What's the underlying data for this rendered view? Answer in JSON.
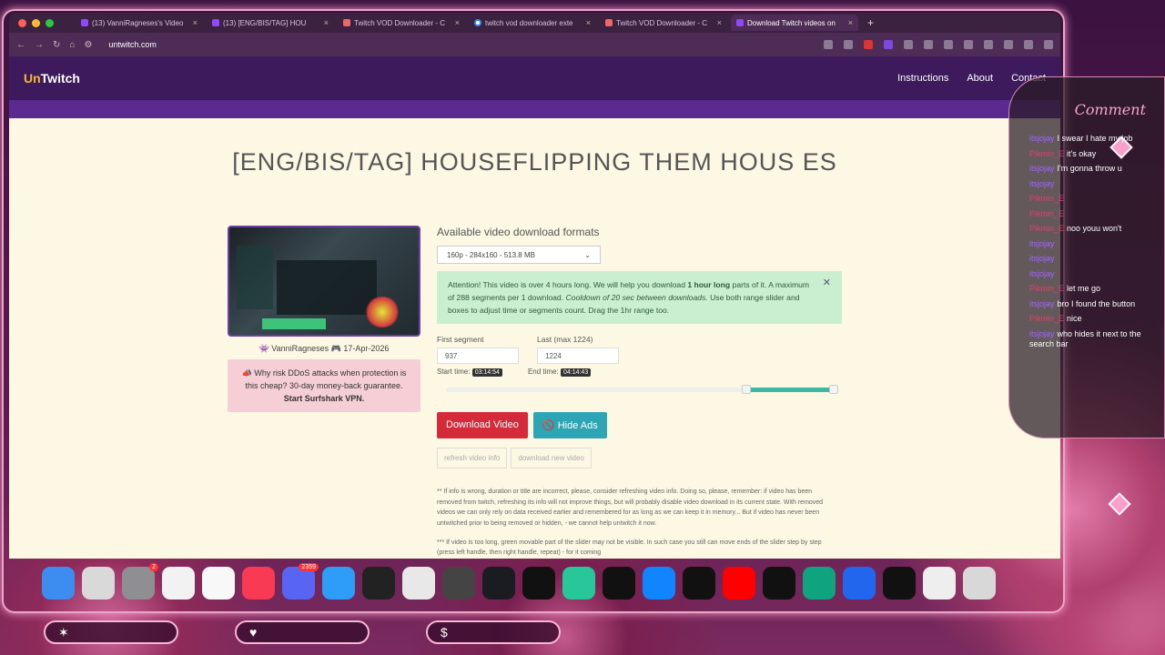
{
  "browser": {
    "tabs": [
      {
        "title": "(13) VanniRagneses's Video",
        "fav": "twitch"
      },
      {
        "title": "(13) [ENG/BIS/TAG] HOU",
        "fav": "twitch"
      },
      {
        "title": "Twitch VOD Downloader - C",
        "fav": "plugin"
      },
      {
        "title": "twitch vod downloader exte",
        "fav": "google"
      },
      {
        "title": "Twitch VOD Downloader - C",
        "fav": "plugin"
      },
      {
        "title": "Download Twitch videos on",
        "fav": "twitch"
      }
    ],
    "url": "untwitch.com"
  },
  "site": {
    "logo_a": "Un",
    "logo_b": "Twitch",
    "nav": [
      "Instructions",
      "About",
      "Contact"
    ]
  },
  "page": {
    "title": "[ENG/BIS/TAG] HOUSEFLIPPING THEM HOUS ES",
    "meta": {
      "author": "VanniRagneses",
      "date": "17-Apr-2026"
    },
    "promo_text": "Why risk DDoS attacks when protection is this cheap? 30-day money-back guarantee.",
    "promo_link": "Start Surfshark VPN.",
    "formats_heading": "Available video download formats",
    "format_selected": "160p - 284x160 - 513.8 MB",
    "alert_text_1": "Attention! This video is over 4 hours long. We will help you download ",
    "alert_bold": "1 hour long",
    "alert_text_2": " parts of it. A maximum of 288 segments per 1 download. ",
    "alert_italic": "Cooldown of 20 sec between downloads.",
    "alert_text_3": " Use both range slider and boxes to adjust time or segments count. Drag the 1hr range too.",
    "first_segment_label": "First segment",
    "first_segment_value": "937",
    "last_segment_label": "Last (max 1224)",
    "last_segment_value": "1224",
    "start_label": "Start time:",
    "start_time": "03:14:54",
    "end_label": "End time:",
    "end_time": "04:14:43",
    "slider_range": [
      0.765,
      0.985
    ],
    "download_button": "Download Video",
    "hide_ads_button": "Hide Ads",
    "refresh_button": "refresh video info",
    "new_video_button": "download new video",
    "note1": "** If info is wrong, duration or title are incorrect, please, consider refreshing video info. Doing so, please, remember: if video has been removed from twitch, refreshing its info will not improve things, but will probably disable video download in its current state. With removed videos we can only rely on data received earlier and remembered for as long as we can keep it in memory... But if video has never been untwitched prior to being removed or hidden, - we cannot help untwitch it now.",
    "note2": "*** If video is too long, green movable part of the slider may not be visible. In such case you still can move ends of the slider step by step (press left handle, then right handle, repeat) - for it coming"
  },
  "dock": {
    "icons": [
      {
        "name": "finder-icon",
        "color": "#3d8df0"
      },
      {
        "name": "launchpad-icon",
        "color": "#d9d9d9"
      },
      {
        "name": "settings-icon",
        "color": "#8e8e93",
        "badge": "2"
      },
      {
        "name": "photos-icon",
        "color": "#f2f2f2"
      },
      {
        "name": "notes-icon",
        "color": "#f8f8f8"
      },
      {
        "name": "music-icon",
        "color": "#fa3a55"
      },
      {
        "name": "discord-icon",
        "color": "#5865f2",
        "badge": "2359"
      },
      {
        "name": "safari-icon",
        "color": "#2e9df7"
      },
      {
        "name": "wave-app-icon",
        "color": "#222"
      },
      {
        "name": "chrome-icon",
        "color": "#e8e8e8"
      },
      {
        "name": "discord-alt-icon",
        "color": "#444"
      },
      {
        "name": "obs-icon",
        "color": "#1b1b22"
      },
      {
        "name": "tiktok-icon",
        "color": "#111"
      },
      {
        "name": "teams-icon",
        "color": "#28c79a"
      },
      {
        "name": "x-icon",
        "color": "#111"
      },
      {
        "name": "bluesky-icon",
        "color": "#1185fe"
      },
      {
        "name": "cursor-icon",
        "color": "#111"
      },
      {
        "name": "youtube-icon",
        "color": "#ff0000"
      },
      {
        "name": "streamlabs-icon",
        "color": "#111"
      },
      {
        "name": "chatgpt-icon",
        "color": "#10a37f"
      },
      {
        "name": "plus-app-icon",
        "color": "#2266ee"
      },
      {
        "name": "capcut-icon",
        "color": "#111"
      },
      {
        "name": "vc-icon",
        "color": "#eeeeee"
      },
      {
        "name": "trash-icon",
        "color": "#d8d8d8"
      }
    ]
  },
  "chat": {
    "title": "Comment",
    "messages": [
      {
        "user": "itsjojay",
        "color": "p",
        "text": "I swear I hate my job"
      },
      {
        "user": "Pikmin_E",
        "color": "r",
        "text": "it's okay"
      },
      {
        "user": "itsjojay",
        "color": "p",
        "text": "I'm gonna throw u"
      },
      {
        "user": "itsjojay",
        "color": "p",
        "text": ""
      },
      {
        "user": "Pikmin_E",
        "color": "r",
        "text": ""
      },
      {
        "user": "Pikmin_E",
        "color": "r",
        "text": ""
      },
      {
        "user": "Pikmin_E",
        "color": "r",
        "text": "noo youu won't"
      },
      {
        "user": "itsjojay",
        "color": "p",
        "text": ""
      },
      {
        "user": "itsjojay",
        "color": "p",
        "text": ""
      },
      {
        "user": "itsjojay",
        "color": "p",
        "text": ""
      },
      {
        "user": "Pikmin_E",
        "color": "r",
        "text": "let me go"
      },
      {
        "user": "itsjojay",
        "color": "p",
        "text": "bro I found the button"
      },
      {
        "user": "Pikmin_E",
        "color": "r",
        "text": "nice"
      },
      {
        "user": "itsjojay",
        "color": "p",
        "text": "who hides it next to the search bar"
      }
    ]
  }
}
